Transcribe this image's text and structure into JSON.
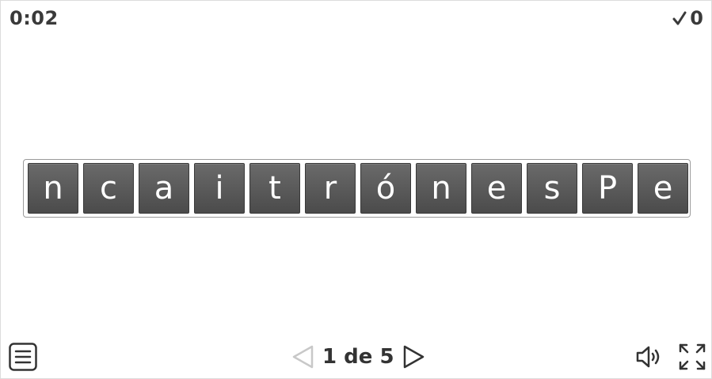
{
  "header": {
    "timer": "0:02",
    "score": "0",
    "score_icon": "checkmark-icon"
  },
  "puzzle": {
    "letters": [
      "n",
      "c",
      "a",
      "i",
      "t",
      "r",
      "ó",
      "n",
      "e",
      "s",
      "P",
      "e"
    ]
  },
  "pager": {
    "current": 1,
    "total": 5,
    "label": "1 de 5",
    "prev_icon": "triangle-left-icon",
    "next_icon": "triangle-right-icon",
    "prev_enabled": false
  },
  "controls": {
    "menu_icon": "menu-icon",
    "sound_icon": "speaker-icon",
    "fullscreen_icon": "fullscreen-icon"
  },
  "colors": {
    "tile": "#555555",
    "text": "#333333",
    "disabled": "#c8c8c8"
  }
}
